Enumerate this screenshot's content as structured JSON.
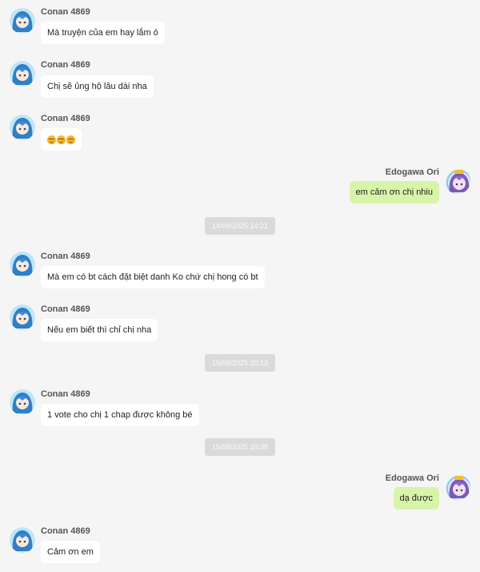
{
  "users": {
    "other": {
      "name": "Conan 4869",
      "avatar_icon": "anime-girl-blue-avatar"
    },
    "self": {
      "name": "Edogawa Ori",
      "avatar_icon": "anime-girl-purple-avatar"
    }
  },
  "messages": [
    {
      "from": "other",
      "text": "Mà truyện của em hay lắm ó"
    },
    {
      "from": "other",
      "text": "Chị sẽ ủng hộ lâu dài nha"
    },
    {
      "from": "other",
      "text": "",
      "emoji": [
        "slightly-smiling-face-icon",
        "slightly-smiling-face-icon",
        "slightly-smiling-face-icon"
      ]
    },
    {
      "from": "self",
      "text": "em cảm ơn chị nhiu"
    },
    {
      "timestamp": "14/09/2025 14:21"
    },
    {
      "from": "other",
      "text": "Mà em có bt cách đặt biệt danh Ko chứ chị hong có bt"
    },
    {
      "from": "other",
      "text": "Nếu em biết thì chỉ chị nha"
    },
    {
      "timestamp": "15/09/2025 20:13"
    },
    {
      "from": "other",
      "text": "1 vote cho chị 1 chap được không bé"
    },
    {
      "timestamp": "15/09/2025 20:38"
    },
    {
      "from": "self",
      "text": "dạ được"
    },
    {
      "from": "other",
      "text": "Cảm ơn em"
    }
  ],
  "colors": {
    "background": "#f5f5f5",
    "incoming_bubble": "#ffffff",
    "outgoing_bubble": "#d7f4a8",
    "timestamp_pill": "#dadada"
  }
}
